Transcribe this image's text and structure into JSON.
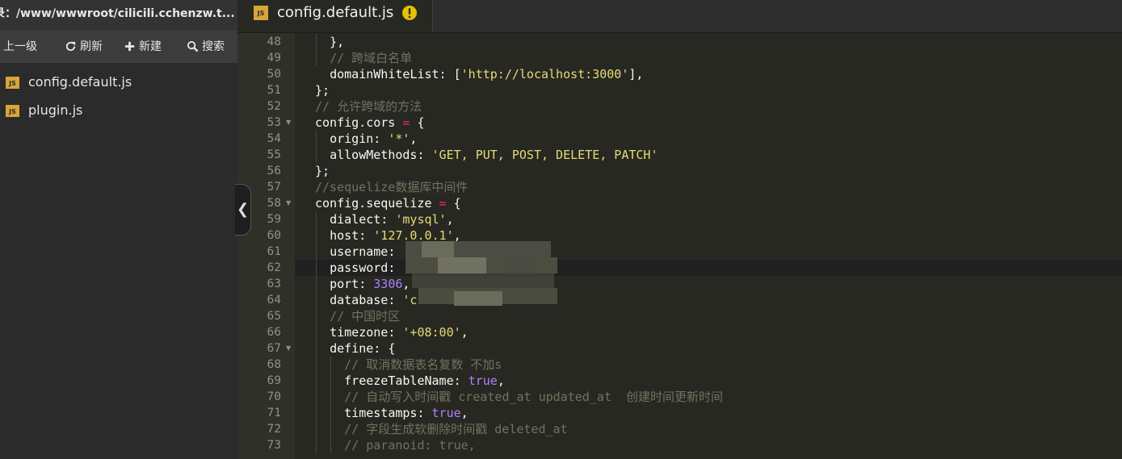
{
  "sidebar": {
    "path_label": "录：/www/wwwroot/cilicili.cchenzw.t...",
    "toolbar": {
      "up_label": "上一级",
      "refresh_label": "刷新",
      "new_label": "新建",
      "search_label": "搜索"
    },
    "files": [
      {
        "name": "config.default.js",
        "icon": "js-file-icon",
        "icon_text": "JS"
      },
      {
        "name": "plugin.js",
        "icon": "js-file-icon",
        "icon_text": "JS"
      }
    ]
  },
  "tabs": {
    "active": {
      "title": "config.default.js",
      "icon_text": "JS",
      "status_icon": "warning-icon"
    }
  },
  "editor": {
    "active_line": 62,
    "line_numbers": [
      48,
      49,
      50,
      51,
      52,
      53,
      54,
      55,
      56,
      57,
      58,
      59,
      60,
      61,
      62,
      63,
      64,
      65,
      66,
      67,
      68,
      69,
      70,
      71,
      72,
      73
    ],
    "fold_lines": [
      53,
      58,
      67
    ],
    "lines": [
      {
        "text": "}",
        "tail": ","
      },
      {
        "comment": "// 跨域白名单"
      },
      {
        "key": "domainWhiteList",
        "sep": ": [",
        "str": "'http://localhost:3000'",
        "tail": "],"
      },
      {
        "text": "};"
      },
      {
        "comment": "// 允许跨域的方法"
      },
      {
        "obj": "config.cors",
        "op": "=",
        "tail": "{"
      },
      {
        "key": "origin",
        "sep": ": ",
        "str": "'*'",
        "tail": ","
      },
      {
        "key": "allowMethods",
        "sep": ": ",
        "str": "'GET, PUT, POST, DELETE, PATCH'",
        "tail": ""
      },
      {
        "text": "};"
      },
      {
        "comment": "//sequelize数据库中间件"
      },
      {
        "obj": "config.sequelize",
        "op": "=",
        "tail": "{"
      },
      {
        "key": "dialect",
        "sep": ": ",
        "str": "'mysql'",
        "tail": ","
      },
      {
        "key": "host",
        "sep": ": ",
        "str": "'127.0.0.1'",
        "tail": ","
      },
      {
        "key": "username",
        "sep": ":",
        "str": "",
        "tail": ""
      },
      {
        "key": "password",
        "sep": ":",
        "str": "",
        "tail": ""
      },
      {
        "key": "port",
        "sep": ": ",
        "num": "3306",
        "tail": ","
      },
      {
        "key": "database",
        "sep": ": ",
        "str": "'c",
        "tail": ""
      },
      {
        "comment": "// 中国时区"
      },
      {
        "key": "timezone",
        "sep": ": ",
        "str": "'+08:00'",
        "tail": ","
      },
      {
        "key": "define",
        "sep": ": ",
        "tail": "{"
      },
      {
        "comment": "// 取消数据表名复数 不加s"
      },
      {
        "key": "freezeTableName",
        "sep": ": ",
        "bool": "true",
        "tail": ","
      },
      {
        "comment": "// 自动写入时间戳 created_at updated_at  创建时间更新时间"
      },
      {
        "key": "timestamps",
        "sep": ": ",
        "bool": "true",
        "tail": ","
      },
      {
        "comment": "// 字段生成软删除时间戳 deleted_at"
      },
      {
        "comment": "// paranoid: true,"
      }
    ]
  },
  "colors": {
    "editor_bg": "#272822",
    "comment": "#75715e",
    "string": "#e6db74",
    "number": "#ae81ff",
    "operator": "#f92672",
    "js_icon": "#d9a53a",
    "warning": "#e5c100"
  },
  "collapse_icon": "chevron-left-icon"
}
